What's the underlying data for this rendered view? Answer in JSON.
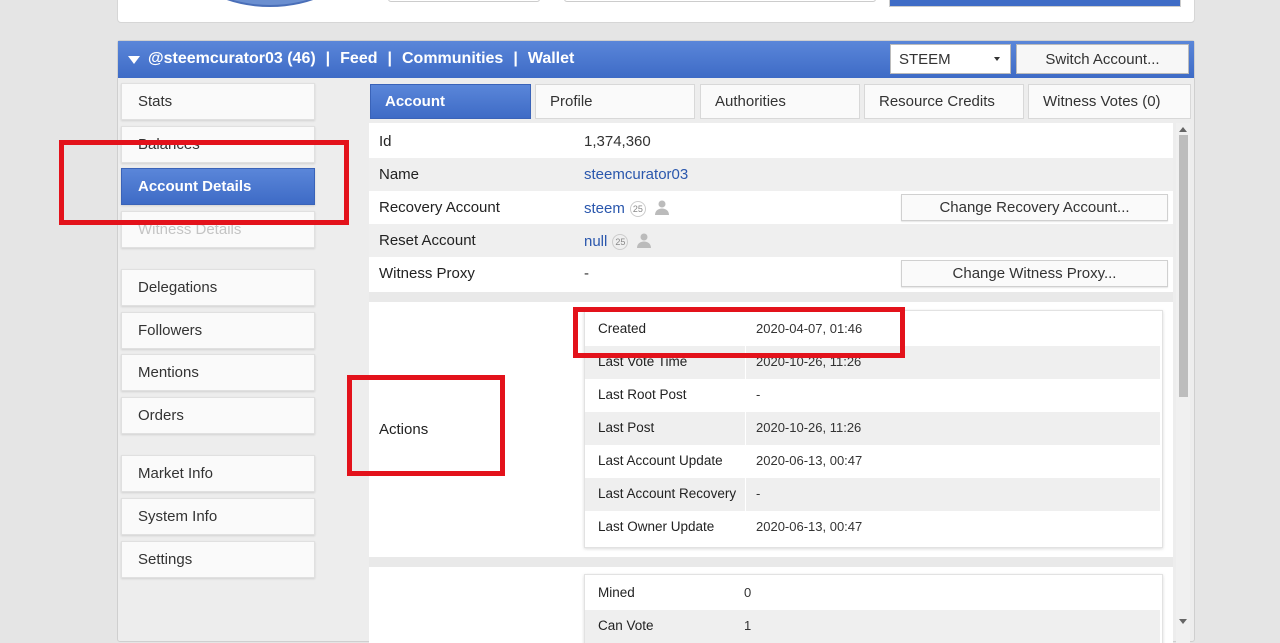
{
  "header": {
    "account": "@steemcurator03 (46)",
    "sep": "|",
    "feed": "Feed",
    "communities": "Communities",
    "wallet": "Wallet",
    "select_value": "STEEM",
    "switch_label": "Switch Account..."
  },
  "sidebar": {
    "items": [
      {
        "label": "Stats"
      },
      {
        "label": "Balances"
      },
      {
        "label": "Account Details"
      },
      {
        "label": "Witness Details"
      },
      {
        "label": "Delegations"
      },
      {
        "label": "Followers"
      },
      {
        "label": "Mentions"
      },
      {
        "label": "Orders"
      },
      {
        "label": "Market Info"
      },
      {
        "label": "System Info"
      },
      {
        "label": "Settings"
      }
    ]
  },
  "tabs": [
    {
      "label": "Account"
    },
    {
      "label": "Profile"
    },
    {
      "label": "Authorities"
    },
    {
      "label": "Resource Credits"
    },
    {
      "label": "Witness Votes (0)"
    }
  ],
  "details": {
    "id_label": "Id",
    "id_value": "1,374,360",
    "name_label": "Name",
    "name_value": "steemcurator03",
    "recovery_label": "Recovery Account",
    "recovery_value": "steem",
    "recovery_badge": "25",
    "recovery_button": "Change Recovery Account...",
    "reset_label": "Reset Account",
    "reset_value": "null",
    "reset_badge": "25",
    "proxy_label": "Witness Proxy",
    "proxy_value": "-",
    "proxy_button": "Change Witness Proxy...",
    "actions_label": "Actions"
  },
  "actions": [
    {
      "key": "Created",
      "value": "2020-04-07, 01:46"
    },
    {
      "key": "Last Vote Time",
      "value": "2020-10-26, 11:26"
    },
    {
      "key": "Last Root Post",
      "value": "-"
    },
    {
      "key": "Last Post",
      "value": "2020-10-26, 11:26"
    },
    {
      "key": "Last Account Update",
      "value": "2020-06-13, 00:47"
    },
    {
      "key": "Last Account Recovery",
      "value": "-"
    },
    {
      "key": "Last Owner Update",
      "value": "2020-06-13, 00:47"
    }
  ],
  "misc": [
    {
      "key": "Mined",
      "value": "0"
    },
    {
      "key": "Can Vote",
      "value": "1"
    }
  ],
  "colors": {
    "accent_blue": "#3e6bc6",
    "link_blue": "#2a57ad",
    "annotation_red": "#e3121b"
  }
}
